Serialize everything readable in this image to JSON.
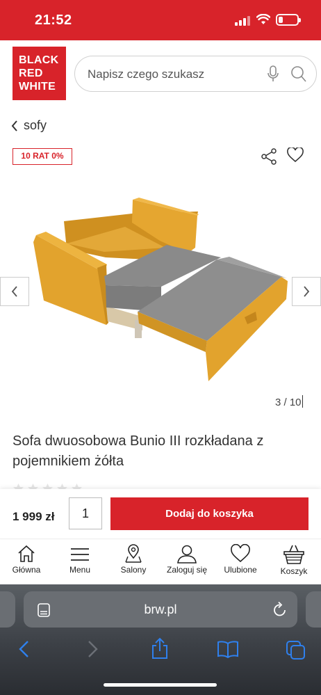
{
  "status_bar": {
    "time": "21:52"
  },
  "header": {
    "logo_lines": [
      "BLACK",
      "RED",
      "WHITE"
    ],
    "search_placeholder": "Napisz czego szukasz"
  },
  "breadcrumb": {
    "back_label": "sofy"
  },
  "badge": {
    "label": "10 RAT 0%"
  },
  "gallery": {
    "counter": "3 / 10",
    "current": 3,
    "total": 10
  },
  "product": {
    "title": "Sofa dwuosobowa Bunio III rozkładana z pojemnikiem żółta",
    "rating_stars": 5,
    "price": "1 999 zł",
    "quantity": "1",
    "add_to_cart_label": "Dodaj do koszyka"
  },
  "bottom_nav": {
    "items": [
      {
        "label": "Główna",
        "icon": "home-icon"
      },
      {
        "label": "Menu",
        "icon": "menu-icon"
      },
      {
        "label": "Salony",
        "icon": "map-pin-icon"
      },
      {
        "label": "Zaloguj się",
        "icon": "user-icon"
      },
      {
        "label": "Ulubione",
        "icon": "heart-icon"
      },
      {
        "label": "Koszyk",
        "icon": "basket-icon"
      }
    ]
  },
  "browser": {
    "url": "brw.pl"
  },
  "colors": {
    "brand": "#d8232a",
    "sofa": "#e2a32d",
    "mattress": "#8a8a8a"
  }
}
